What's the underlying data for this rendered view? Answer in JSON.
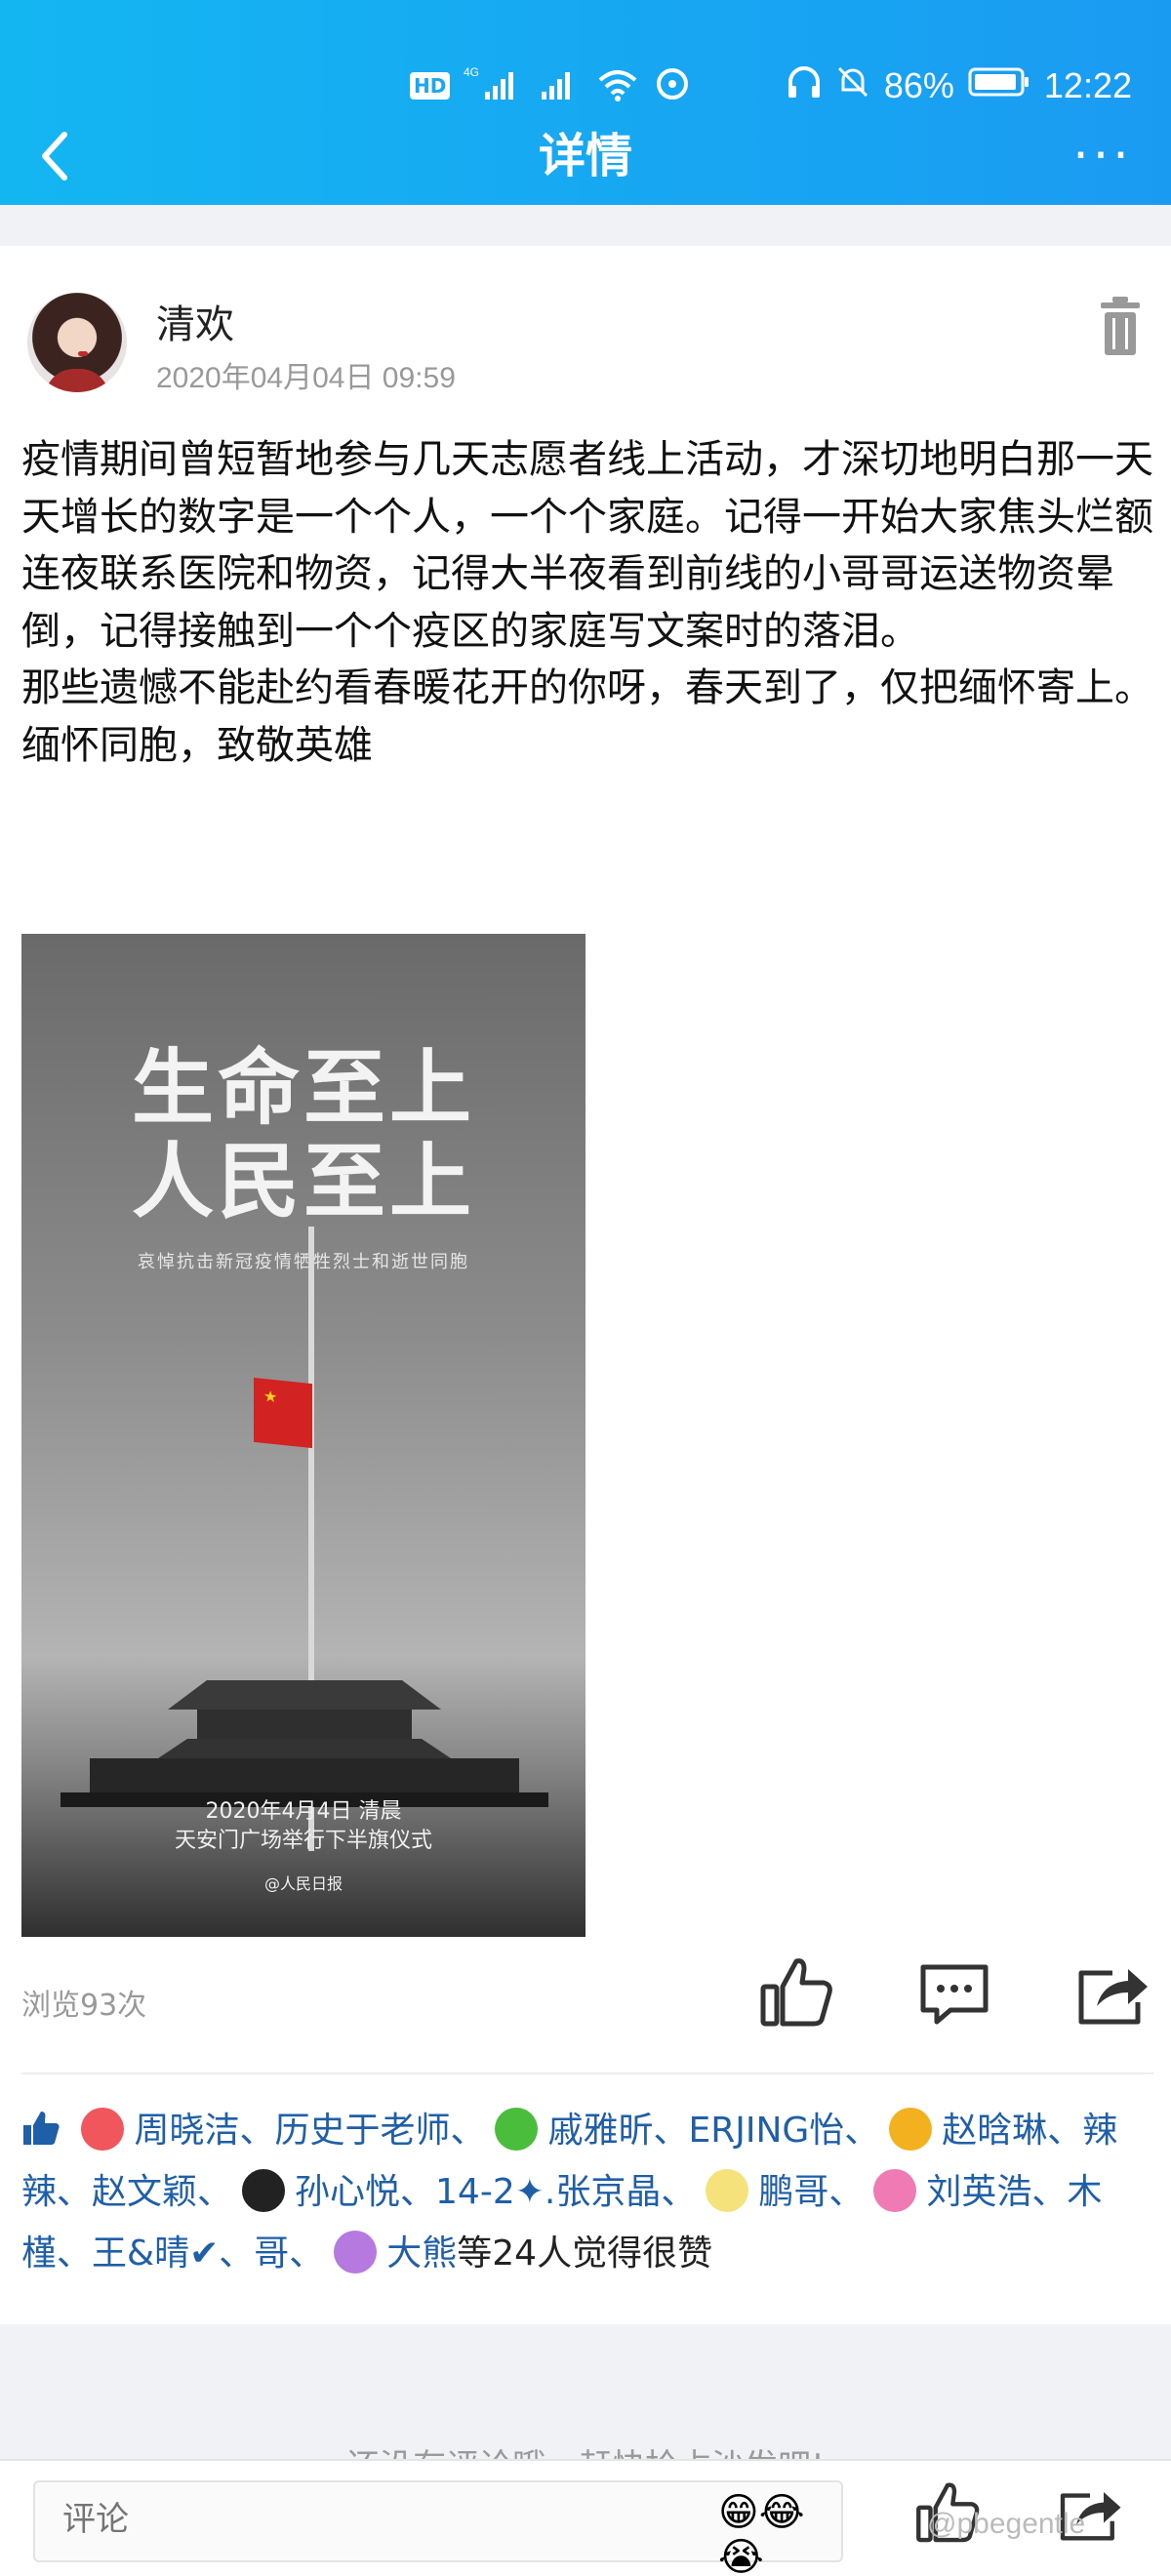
{
  "status_bar": {
    "hd_label": "HD",
    "network_label": "4G",
    "battery": "86%",
    "time": "12:22"
  },
  "nav": {
    "title": "详情",
    "back_icon": "chevron-left-icon",
    "more_icon": "more-horizontal-icon",
    "more_glyph": "···"
  },
  "post": {
    "author": "清欢",
    "time": "2020年04月04日 09:59",
    "body": "疫情期间曾短暂地参与几天志愿者线上活动，才深切地明白那一天天增长的数字是一个个人，一个个家庭。记得一开始大家焦头烂额连夜联系医院和物资，记得大半夜看到前线的小哥哥运送物资晕倒，记得接触到一个个疫区的家庭写文案时的落泪。\n那些遗憾不能赴约看春暖花开的你呀，春天到了，仅把缅怀寄上。\n缅怀同胞，致敬英雄",
    "image": {
      "headline_line1": "生命至上",
      "headline_line2": "人民至上",
      "subtitle": "哀悼抗击新冠疫情牺牲烈士和逝世同胞",
      "date_line1": "2020年4月4日 清晨",
      "date_line2": "天安门广场举行下半旗仪式",
      "brand": "@人民日报"
    },
    "views": "浏览93次"
  },
  "likes": {
    "names_a": "周晓洁、历史于老师、",
    "names_b": "戚雅昕、ERJING怡、",
    "names_c": "赵晗琳、辣辣、赵文颖、",
    "names_d": "孙心悦、14-2✦.张京晶、",
    "names_e": "鹏哥、",
    "names_f": "刘英浩、木槿、王&晴✔、哥、",
    "names_g": "大熊",
    "tail": "等24人觉得很赞"
  },
  "comments": {
    "empty_hint": "还没有评论哦，赶快抢占沙发吧!"
  },
  "bottom_bar": {
    "comment_placeholder": "评论",
    "emojis": "😁😂😭"
  },
  "watermark": "@pbegentle",
  "colors": {
    "header_gradient_start": "#14b6f2",
    "header_gradient_end": "#1a9bf2",
    "link_blue": "#1e5fa8"
  }
}
